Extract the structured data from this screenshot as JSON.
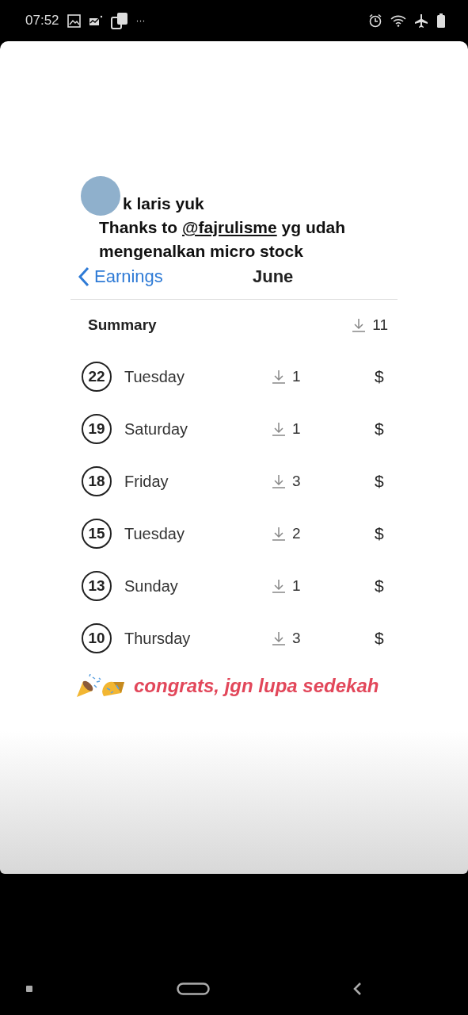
{
  "status_bar": {
    "time": "07:52",
    "more": "···"
  },
  "story": {
    "caption_lines": [
      "k laris yuk",
      "Thanks to **@fajrulisme** yg udah",
      "mengenalkan micro stock"
    ]
  },
  "earnings": {
    "back_label": "Earnings",
    "title": "June",
    "summary": {
      "label": "Summary",
      "downloads": "11"
    },
    "days": [
      {
        "day": "22",
        "weekday": "Tuesday",
        "downloads": "1",
        "amount": "$"
      },
      {
        "day": "19",
        "weekday": "Saturday",
        "downloads": "1",
        "amount": "$"
      },
      {
        "day": "18",
        "weekday": "Friday",
        "downloads": "3",
        "amount": "$"
      },
      {
        "day": "15",
        "weekday": "Tuesday",
        "downloads": "2",
        "amount": "$"
      },
      {
        "day": "13",
        "weekday": "Sunday",
        "downloads": "1",
        "amount": "$"
      },
      {
        "day": "10",
        "weekday": "Thursday",
        "downloads": "3",
        "amount": "$"
      }
    ]
  },
  "sticker_text": "congrats, jgn lupa sedekah"
}
